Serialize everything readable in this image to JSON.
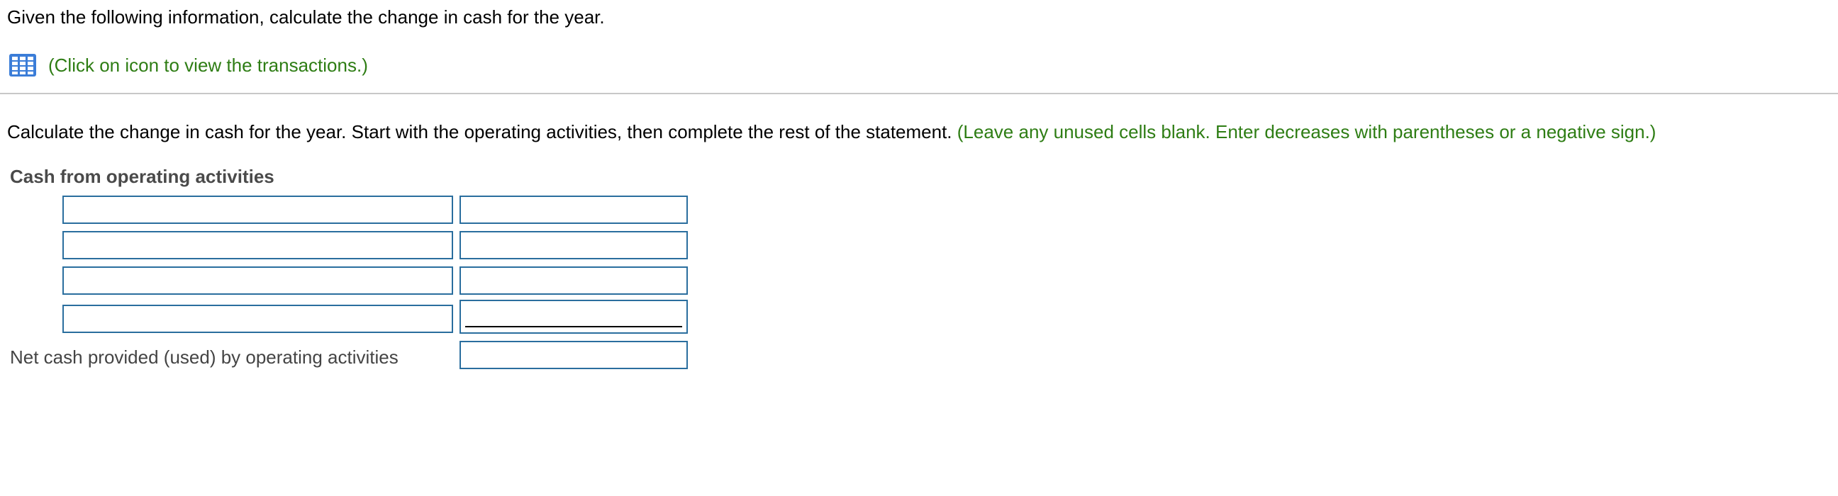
{
  "question": {
    "text": "Given the following information, calculate the change in cash for the year."
  },
  "transactions": {
    "icon": "table-icon",
    "link_text": "(Click on icon to view the transactions.)"
  },
  "instruction": {
    "text": "Calculate the change in cash for the year. Start with the operating activities, then complete the rest of the statement.",
    "hint": "(Leave any unused cells blank. Enter decreases with parentheses or a negative sign.)"
  },
  "statement": {
    "heading": "Cash from operating activities",
    "rows": [
      {
        "label_value": "",
        "amount_value": ""
      },
      {
        "label_value": "",
        "amount_value": ""
      },
      {
        "label_value": "",
        "amount_value": ""
      },
      {
        "label_value": "",
        "amount_value": ""
      }
    ],
    "net_label": "Net cash provided (used) by operating activities",
    "net_value": ""
  },
  "colors": {
    "accent_green": "#2e7d14",
    "input_border": "#2a6e9e",
    "icon_blue": "#3b7dd8"
  }
}
